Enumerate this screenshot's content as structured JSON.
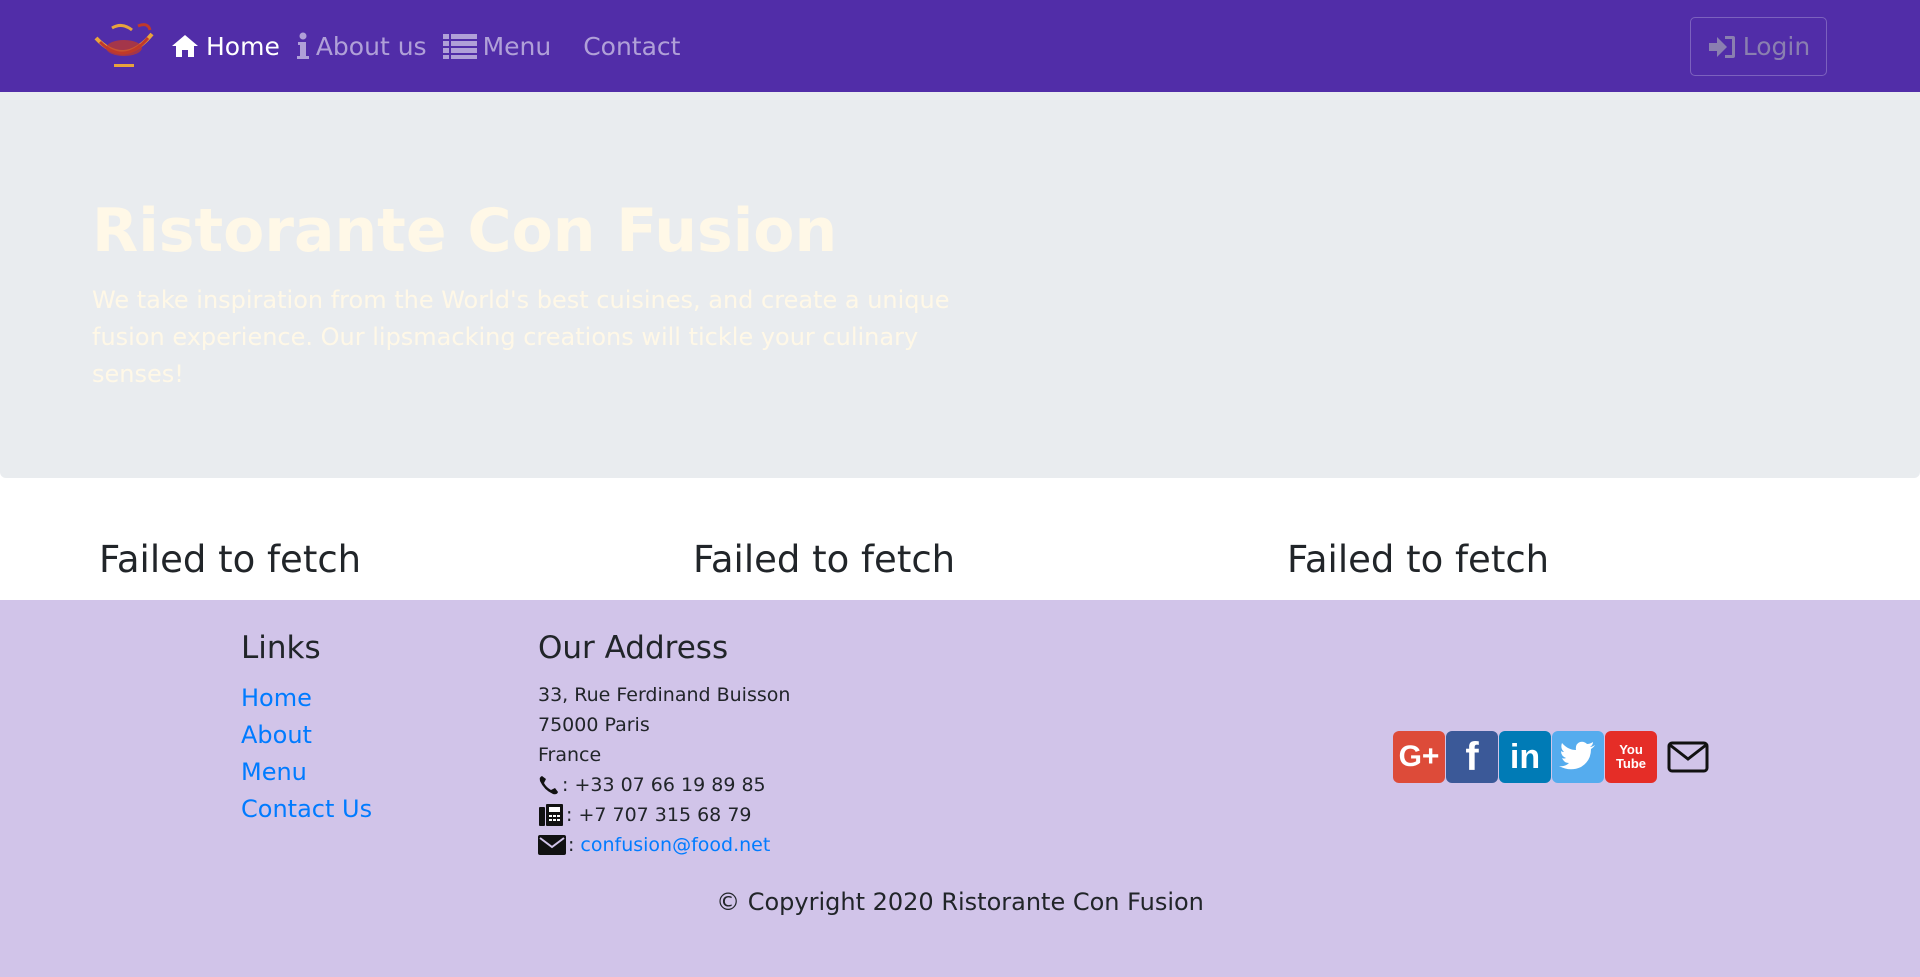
{
  "navbar": {
    "brand_logo": "ristorante-con-fusion-logo",
    "items": [
      {
        "label": "Home",
        "icon": "home-icon",
        "active": true
      },
      {
        "label": "About us",
        "icon": "info-icon",
        "active": false
      },
      {
        "label": "Menu",
        "icon": "list-icon",
        "active": false
      },
      {
        "label": "Contact",
        "icon": "",
        "active": false
      }
    ],
    "login_label": "Login",
    "login_icon": "sign-in-icon",
    "background": "#512DA8"
  },
  "jumbotron": {
    "title": "Ristorante Con Fusion",
    "text": "We take inspiration from the World's best cuisines, and create a unique fusion experience. Our lipsmacking creations will tickle your culinary senses!",
    "background": "#e9ecef"
  },
  "fetch_errors": [
    "Failed to fetch",
    "Failed to fetch",
    "Failed to fetch"
  ],
  "footer": {
    "links_heading": "Links",
    "links": [
      "Home",
      "About",
      "Menu",
      "Contact Us"
    ],
    "address_heading": "Our Address",
    "address_lines": [
      "33, Rue Ferdinand Buisson",
      "75000 Paris",
      "France"
    ],
    "phone": ": +33 07 66 19 89 85",
    "fax": ": +7 707 315 68 79",
    "email_sep": ":",
    "email": "confusion@food.net",
    "social": [
      {
        "name": "google-plus",
        "glyph": "G+"
      },
      {
        "name": "facebook",
        "glyph": "f"
      },
      {
        "name": "linkedin",
        "glyph": "in"
      },
      {
        "name": "twitter",
        "glyph": ""
      },
      {
        "name": "youtube",
        "glyph": "You Tube"
      },
      {
        "name": "mail",
        "glyph": ""
      }
    ],
    "copyright": "© Copyright 2020 Ristorante Con Fusion",
    "background": "#D1C4E9"
  }
}
